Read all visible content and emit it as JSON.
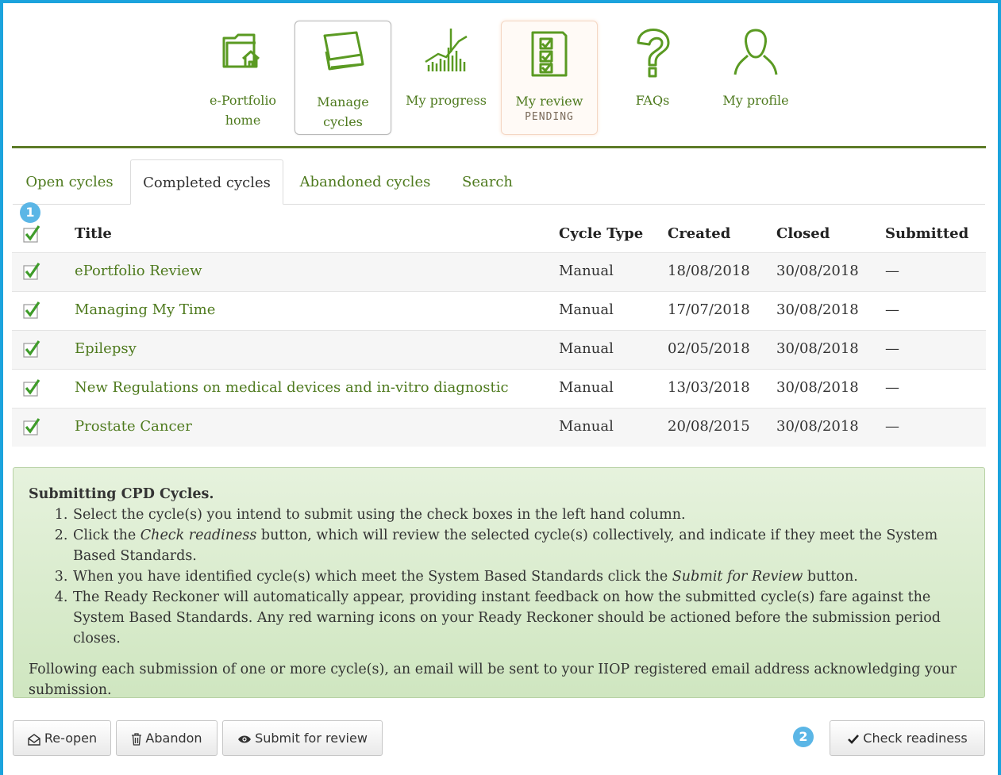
{
  "nav": {
    "items": [
      {
        "label": "e-Portfolio home",
        "icon": "portfolio-home-icon"
      },
      {
        "label": "Manage cycles",
        "icon": "manage-cycles-icon"
      },
      {
        "label": "My progress",
        "icon": "progress-chart-icon"
      },
      {
        "label": "My review",
        "sub": "PENDING",
        "icon": "review-checklist-icon"
      },
      {
        "label": "FAQs",
        "icon": "question-icon"
      },
      {
        "label": "My profile",
        "icon": "profile-icon"
      }
    ]
  },
  "tabs": [
    "Open cycles",
    "Completed cycles",
    "Abandoned cycles",
    "Search"
  ],
  "badges": {
    "one": "1",
    "two": "2"
  },
  "table": {
    "headers": {
      "title": "Title",
      "type": "Cycle Type",
      "created": "Created",
      "closed": "Closed",
      "submitted": "Submitted"
    },
    "rows": [
      {
        "title": "ePortfolio Review",
        "type": "Manual",
        "created": "18/08/2018",
        "closed": "30/08/2018",
        "submitted": "—"
      },
      {
        "title": "Managing My Time",
        "type": "Manual",
        "created": "17/07/2018",
        "closed": "30/08/2018",
        "submitted": "—"
      },
      {
        "title": "Epilepsy",
        "type": "Manual",
        "created": "02/05/2018",
        "closed": "30/08/2018",
        "submitted": "—"
      },
      {
        "title": "New Regulations on medical devices and in-vitro diagnostic",
        "type": "Manual",
        "created": "13/03/2018",
        "closed": "30/08/2018",
        "submitted": "—"
      },
      {
        "title": "Prostate Cancer",
        "type": "Manual",
        "created": "20/08/2015",
        "closed": "30/08/2018",
        "submitted": "—"
      }
    ]
  },
  "info": {
    "heading": "Submitting CPD Cycles.",
    "step1": "Select the cycle(s) you intend to submit using the check boxes in the left hand column.",
    "step2_pre": "Click the ",
    "step2_em": "Check readiness",
    "step2_post": " button, which will review the selected cycle(s) collectively, and indicate if they meet the System Based Standards.",
    "step3_pre": "When you have identified cycle(s) which meet the System Based Standards click the ",
    "step3_em": "Submit for Review",
    "step3_post": " button.",
    "step4": "The Ready Reckoner will automatically appear, providing instant feedback on how the submitted cycle(s) fare against the System Based Standards. Any red warning icons on your Ready Reckoner should be actioned before the submission period closes.",
    "footer": "Following each submission of one or more cycle(s), an email will be sent to your IIOP registered email address acknowledging your submission."
  },
  "buttons": {
    "reopen": "Re-open",
    "abandon": "Abandon",
    "submit": "Submit for review",
    "check": "Check readiness"
  },
  "colors": {
    "accent_green": "#4e7a1e",
    "frame_blue": "#1ba3dd",
    "badge_blue": "#5bb6e6",
    "info_bg": "#dcecd1"
  }
}
